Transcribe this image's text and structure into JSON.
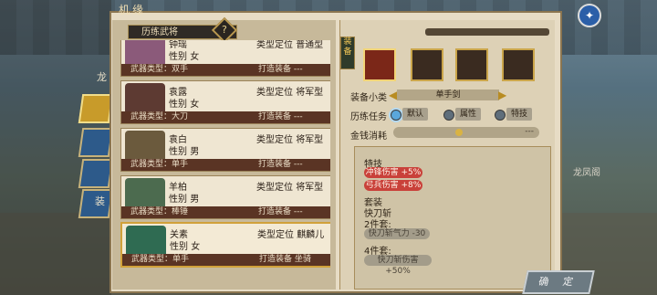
{
  "window_title": "机缘",
  "tab": {
    "label": "历练武将"
  },
  "help_label": "?",
  "corner_icon": "compass-icon",
  "side": {
    "tab_char_top": "龙",
    "tab_char_bottom": "装"
  },
  "town_label": "龙凤阁",
  "labels": {
    "sex_prefix": "性别",
    "type_prefix": "类型定位",
    "weapon_prefix": "武器类型：",
    "equip_prefix": "打造装备"
  },
  "generals": [
    {
      "name": "钟瑶",
      "sex": "女",
      "type": "普通型",
      "weapon": "双手",
      "equip": "---"
    },
    {
      "name": "袁露",
      "sex": "女",
      "type": "将军型",
      "weapon": "大刀",
      "equip": "---"
    },
    {
      "name": "袁白",
      "sex": "男",
      "type": "将军型",
      "weapon": "单手",
      "equip": "---"
    },
    {
      "name": "羊柏",
      "sex": "男",
      "type": "将军型",
      "weapon": "棒锤",
      "equip": "---"
    },
    {
      "name": "关素",
      "sex": "女",
      "type": "麒麟儿",
      "weapon": "单手",
      "equip": "坐骑"
    }
  ],
  "equip_tag": "装备",
  "equip": {
    "subtype_label": "装备小类",
    "subtype_value": "单手剑",
    "task_label": "历练任务",
    "task_options": [
      {
        "label": "默认",
        "on": true
      },
      {
        "label": "属性",
        "on": false
      },
      {
        "label": "特技",
        "on": false
      }
    ],
    "money_label": "金钱消耗",
    "money_value": "---",
    "money_level": 0.45
  },
  "effects": {
    "skill_title": "特技",
    "skills": [
      "冲锋伤害 +5%",
      "弓兵伤害 +8%"
    ],
    "set_title": "套装",
    "set_name": "快刀斩",
    "set2_label": "2件套:",
    "set2_value": "快刀斩气力 -30",
    "set4_label": "4件套:",
    "set4_value": "快刀斩伤害 +50%"
  },
  "confirm_label": "确 定",
  "colors": {
    "panel": "#e7dcc5",
    "bar": "#5a3424",
    "accent": "#d1a13a",
    "red": "#c9413a"
  }
}
